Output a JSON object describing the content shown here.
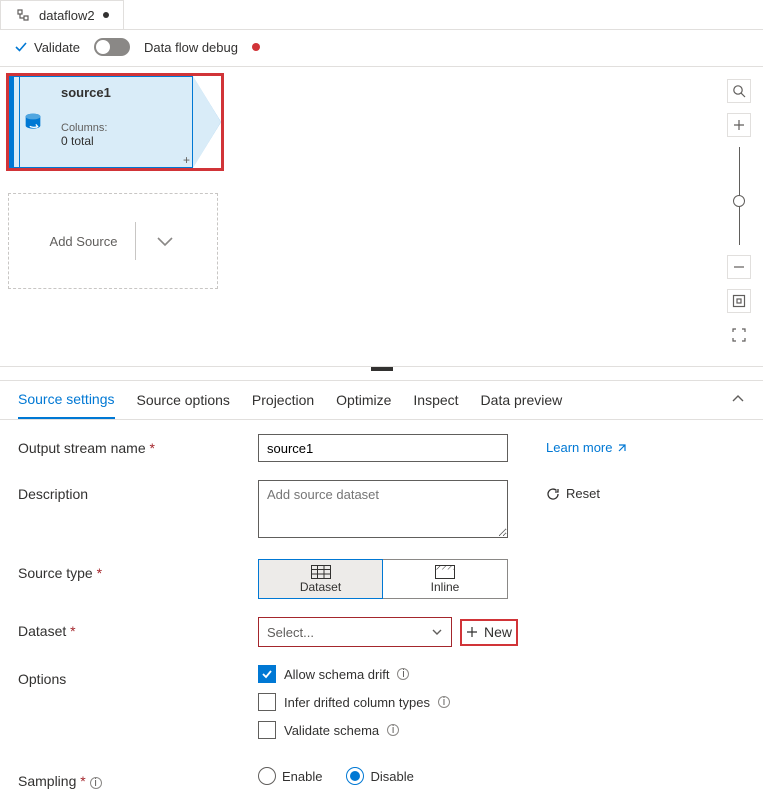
{
  "tab_title": "dataflow2",
  "toolbar": {
    "validate": "Validate",
    "debug": "Data flow debug"
  },
  "source_node": {
    "name": "source1",
    "columns_label": "Columns:",
    "columns_count": "0 total"
  },
  "add_source": "Add Source",
  "panel_tabs": {
    "source_settings": "Source settings",
    "source_options": "Source options",
    "projection": "Projection",
    "optimize": "Optimize",
    "inspect": "Inspect",
    "data_preview": "Data preview"
  },
  "labels": {
    "output_stream": "Output stream name",
    "description": "Description",
    "source_type": "Source type",
    "dataset": "Dataset",
    "options": "Options",
    "sampling": "Sampling"
  },
  "values": {
    "output_stream": "source1",
    "description_placeholder": "Add source dataset",
    "dataset_placeholder": "Select..."
  },
  "source_type_options": {
    "dataset": "Dataset",
    "inline": "Inline"
  },
  "links": {
    "learn_more": "Learn more",
    "reset": "Reset",
    "new": "New"
  },
  "options": {
    "allow_drift": "Allow schema drift",
    "infer_types": "Infer drifted column types",
    "validate_schema": "Validate schema"
  },
  "sampling": {
    "enable": "Enable",
    "disable": "Disable"
  }
}
